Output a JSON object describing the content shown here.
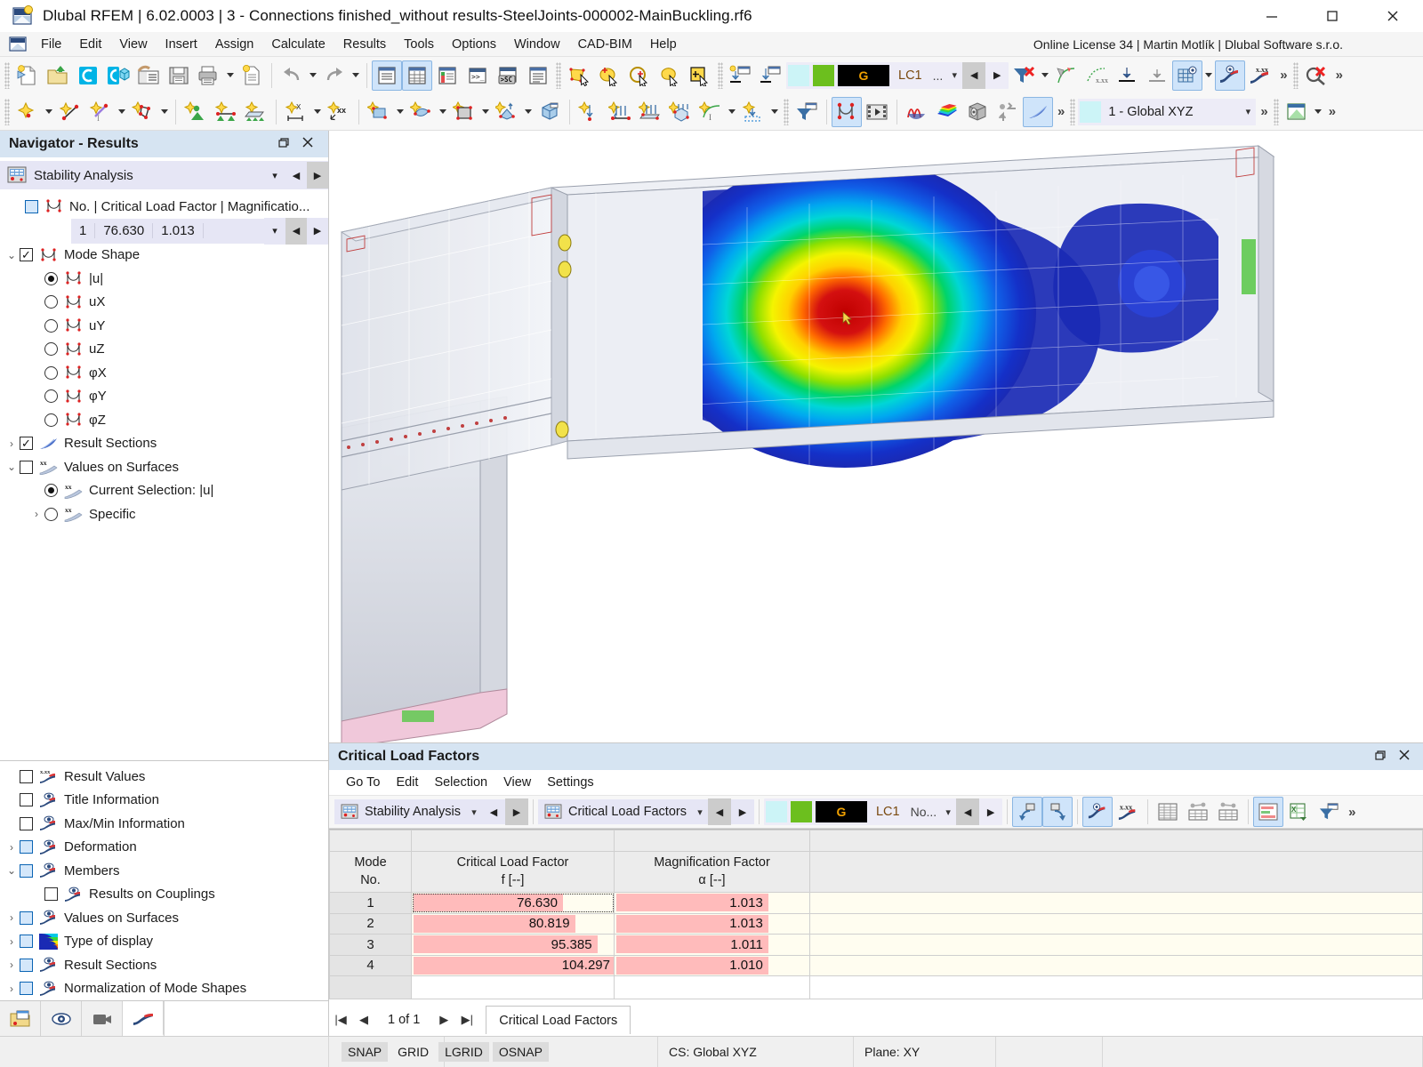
{
  "window": {
    "title": "Dlubal RFEM | 6.02.0003 | 3 - Connections finished_without results-SteelJoints-000002-MainBuckling.rf6",
    "minimize": "—",
    "maximize": "□",
    "close": "✕"
  },
  "menubar": {
    "items": [
      "File",
      "Edit",
      "View",
      "Insert",
      "Assign",
      "Calculate",
      "Results",
      "Tools",
      "Options",
      "Window",
      "CAD-BIM",
      "Help"
    ],
    "license": "Online License 34 | Martin Motlík | Dlubal Software s.r.o."
  },
  "toolbar": {
    "load_case_label": "LC1",
    "load_case_dots": "...",
    "g_label": "G",
    "coord_system": "1 - Global XYZ",
    "overflow": "»"
  },
  "navigator": {
    "title": "Navigator - Results",
    "restore_icon": "▣",
    "close_icon": "✕",
    "category": "Stability Analysis",
    "mode_header": "No. | Critical Load Factor | Magnificatio...",
    "mode_row": {
      "no": "1",
      "critical_load_factor": "76.630",
      "magnification_factor": "1.013"
    },
    "tree": [
      {
        "label": "Mode Shape",
        "type": "checkbox-checked",
        "expander": "⌄",
        "icon": "mode-shape-icon",
        "indent": 0
      },
      {
        "label": "|u|",
        "type": "radio-selected",
        "icon": "mode-shape-icon",
        "indent": 1
      },
      {
        "label": "uX",
        "type": "radio",
        "icon": "mode-shape-icon",
        "indent": 1
      },
      {
        "label": "uY",
        "type": "radio",
        "icon": "mode-shape-icon",
        "indent": 1
      },
      {
        "label": "uZ",
        "type": "radio",
        "icon": "mode-shape-icon",
        "indent": 1
      },
      {
        "label": "φX",
        "type": "radio",
        "icon": "mode-shape-icon",
        "indent": 1
      },
      {
        "label": "φY",
        "type": "radio",
        "icon": "mode-shape-icon",
        "indent": 1
      },
      {
        "label": "φZ",
        "type": "radio",
        "icon": "mode-shape-icon",
        "indent": 1
      },
      {
        "label": "Result Sections",
        "type": "checkbox-checked",
        "expander": "›",
        "icon": "result-section-icon",
        "indent": 0
      },
      {
        "label": "Values on Surfaces",
        "type": "checkbox",
        "expander": "⌄",
        "icon": "values-on-surfaces-icon",
        "indent": 0
      },
      {
        "label": "Current Selection: |u|",
        "type": "radio-selected",
        "icon": "values-on-surfaces-icon",
        "indent": 1
      },
      {
        "label": "Specific",
        "type": "radio",
        "expander": "›",
        "icon": "values-on-surfaces-icon",
        "indent": 1
      }
    ],
    "display_tree": [
      {
        "label": "Result Values",
        "type": "checkbox",
        "icon": "result-values-icon",
        "indent": 0
      },
      {
        "label": "Title Information",
        "type": "checkbox",
        "icon": "eye-display-icon",
        "indent": 0
      },
      {
        "label": "Max/Min Information",
        "type": "checkbox",
        "icon": "eye-display-icon",
        "indent": 0
      },
      {
        "label": "Deformation",
        "type": "checkbox-blue",
        "expander": "›",
        "icon": "eye-display-icon",
        "indent": 0
      },
      {
        "label": "Members",
        "type": "checkbox-blue",
        "expander": "⌄",
        "icon": "eye-display-icon",
        "indent": 0
      },
      {
        "label": "Results on Couplings",
        "type": "checkbox",
        "icon": "eye-display-icon",
        "indent": 1
      },
      {
        "label": "Values on Surfaces",
        "type": "checkbox-blue",
        "expander": "›",
        "icon": "eye-display-icon",
        "indent": 0
      },
      {
        "label": "Type of display",
        "type": "checkbox-blue",
        "expander": "›",
        "icon": "color-ramp-icon",
        "indent": 0
      },
      {
        "label": "Result Sections",
        "type": "checkbox-blue",
        "expander": "›",
        "icon": "eye-display-icon",
        "indent": 0
      },
      {
        "label": "Normalization of Mode Shapes",
        "type": "checkbox-blue",
        "expander": "›",
        "icon": "eye-display-icon",
        "indent": 0
      }
    ],
    "tabs": [
      "project-navigator-tab",
      "view-tab",
      "camera-tab",
      "results-tab"
    ]
  },
  "results_panel": {
    "title": "Critical Load Factors",
    "restore_icon": "▣",
    "close_icon": "✕",
    "menu": [
      "Go To",
      "Edit",
      "Selection",
      "View",
      "Settings"
    ],
    "combo_left": "Stability Analysis",
    "combo_right": "Critical Load Factors",
    "load_case_label": "LC1",
    "g_label": "G",
    "no_label": "No...",
    "pager": {
      "first": "|◀",
      "prev": "◀",
      "text": "1 of 1",
      "next": "▶",
      "last": "▶|"
    },
    "tab": "Critical Load Factors"
  },
  "table": {
    "headers": {
      "mode": [
        "Mode",
        "No."
      ],
      "critical_load_factor": [
        "Critical Load Factor",
        "f [--]"
      ],
      "magnification_factor": [
        "Magnification Factor",
        "α [--]"
      ]
    },
    "rows": [
      {
        "no": "1",
        "f": "76.630",
        "alpha": "1.013",
        "f_bar_pct": 74,
        "a_bar_pct": 78,
        "selected": true
      },
      {
        "no": "2",
        "f": "80.819",
        "alpha": "1.013",
        "f_bar_pct": 80,
        "a_bar_pct": 78,
        "selected": false
      },
      {
        "no": "3",
        "f": "95.385",
        "alpha": "1.011",
        "f_bar_pct": 91,
        "a_bar_pct": 78,
        "selected": false
      },
      {
        "no": "4",
        "f": "104.297",
        "alpha": "1.010",
        "f_bar_pct": 100,
        "a_bar_pct": 78,
        "selected": false
      }
    ]
  },
  "statusbar": {
    "toggles": [
      "SNAP",
      "GRID",
      "LGRID",
      "OSNAP"
    ],
    "toggles_on": [
      "SNAP",
      "LGRID",
      "OSNAP"
    ],
    "cs": "CS: Global XYZ",
    "plane": "Plane: XY"
  },
  "colors": {
    "accent": "#d6e4f2",
    "combo_bg": "#e6e6f5",
    "bar_red": "#ffbbbb",
    "cell_bg": "#fffdf0",
    "green_swatch": "#6cbf1e",
    "cyan_swatch": "#ccf4f7",
    "license_text": "#1b1b1b"
  }
}
